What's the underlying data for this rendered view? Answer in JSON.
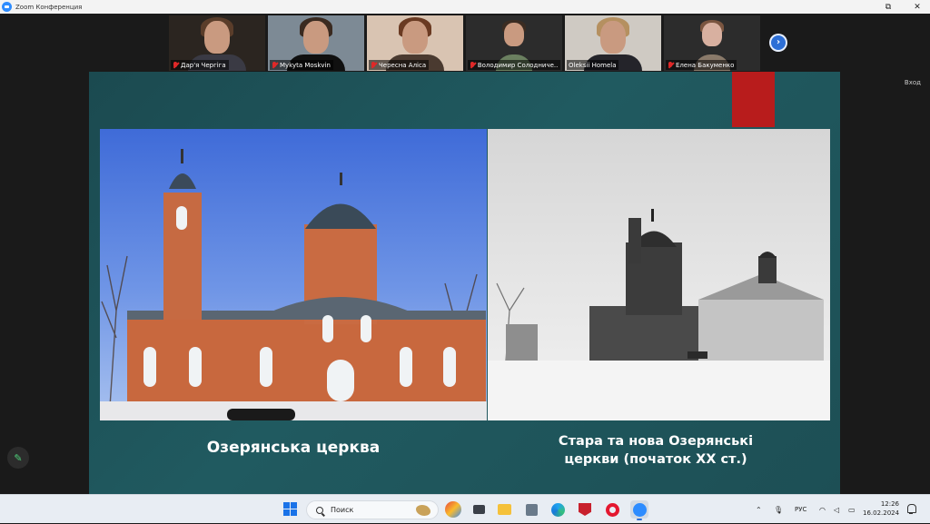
{
  "window": {
    "title": "Zoom Конференция",
    "controls": [
      "⧉",
      "✕"
    ]
  },
  "participants": [
    {
      "name": "Дар'я Чергiга",
      "muted": true
    },
    {
      "name": "Mykyta Moskvin",
      "muted": true
    },
    {
      "name": "Чересна Аліса",
      "muted": true
    },
    {
      "name": "Володимир Солодниче...",
      "muted": true
    },
    {
      "name": "Oleksii Homela",
      "muted": false
    },
    {
      "name": "Елена Бакуменко",
      "muted": true
    }
  ],
  "next_page_glyph": "›",
  "exit_label": "Вход",
  "slide": {
    "caption_left": "Озерянська церква",
    "caption_right_line1": "Стара та нова Озерянські",
    "caption_right_line2": "церкви (початок XX ст.)",
    "accent_color": "#b81c1c",
    "background_color": "#1f555b"
  },
  "taskbar": {
    "search_placeholder": "Поиск",
    "language": "РУС",
    "time": "12:26",
    "date": "16.02.2024"
  }
}
